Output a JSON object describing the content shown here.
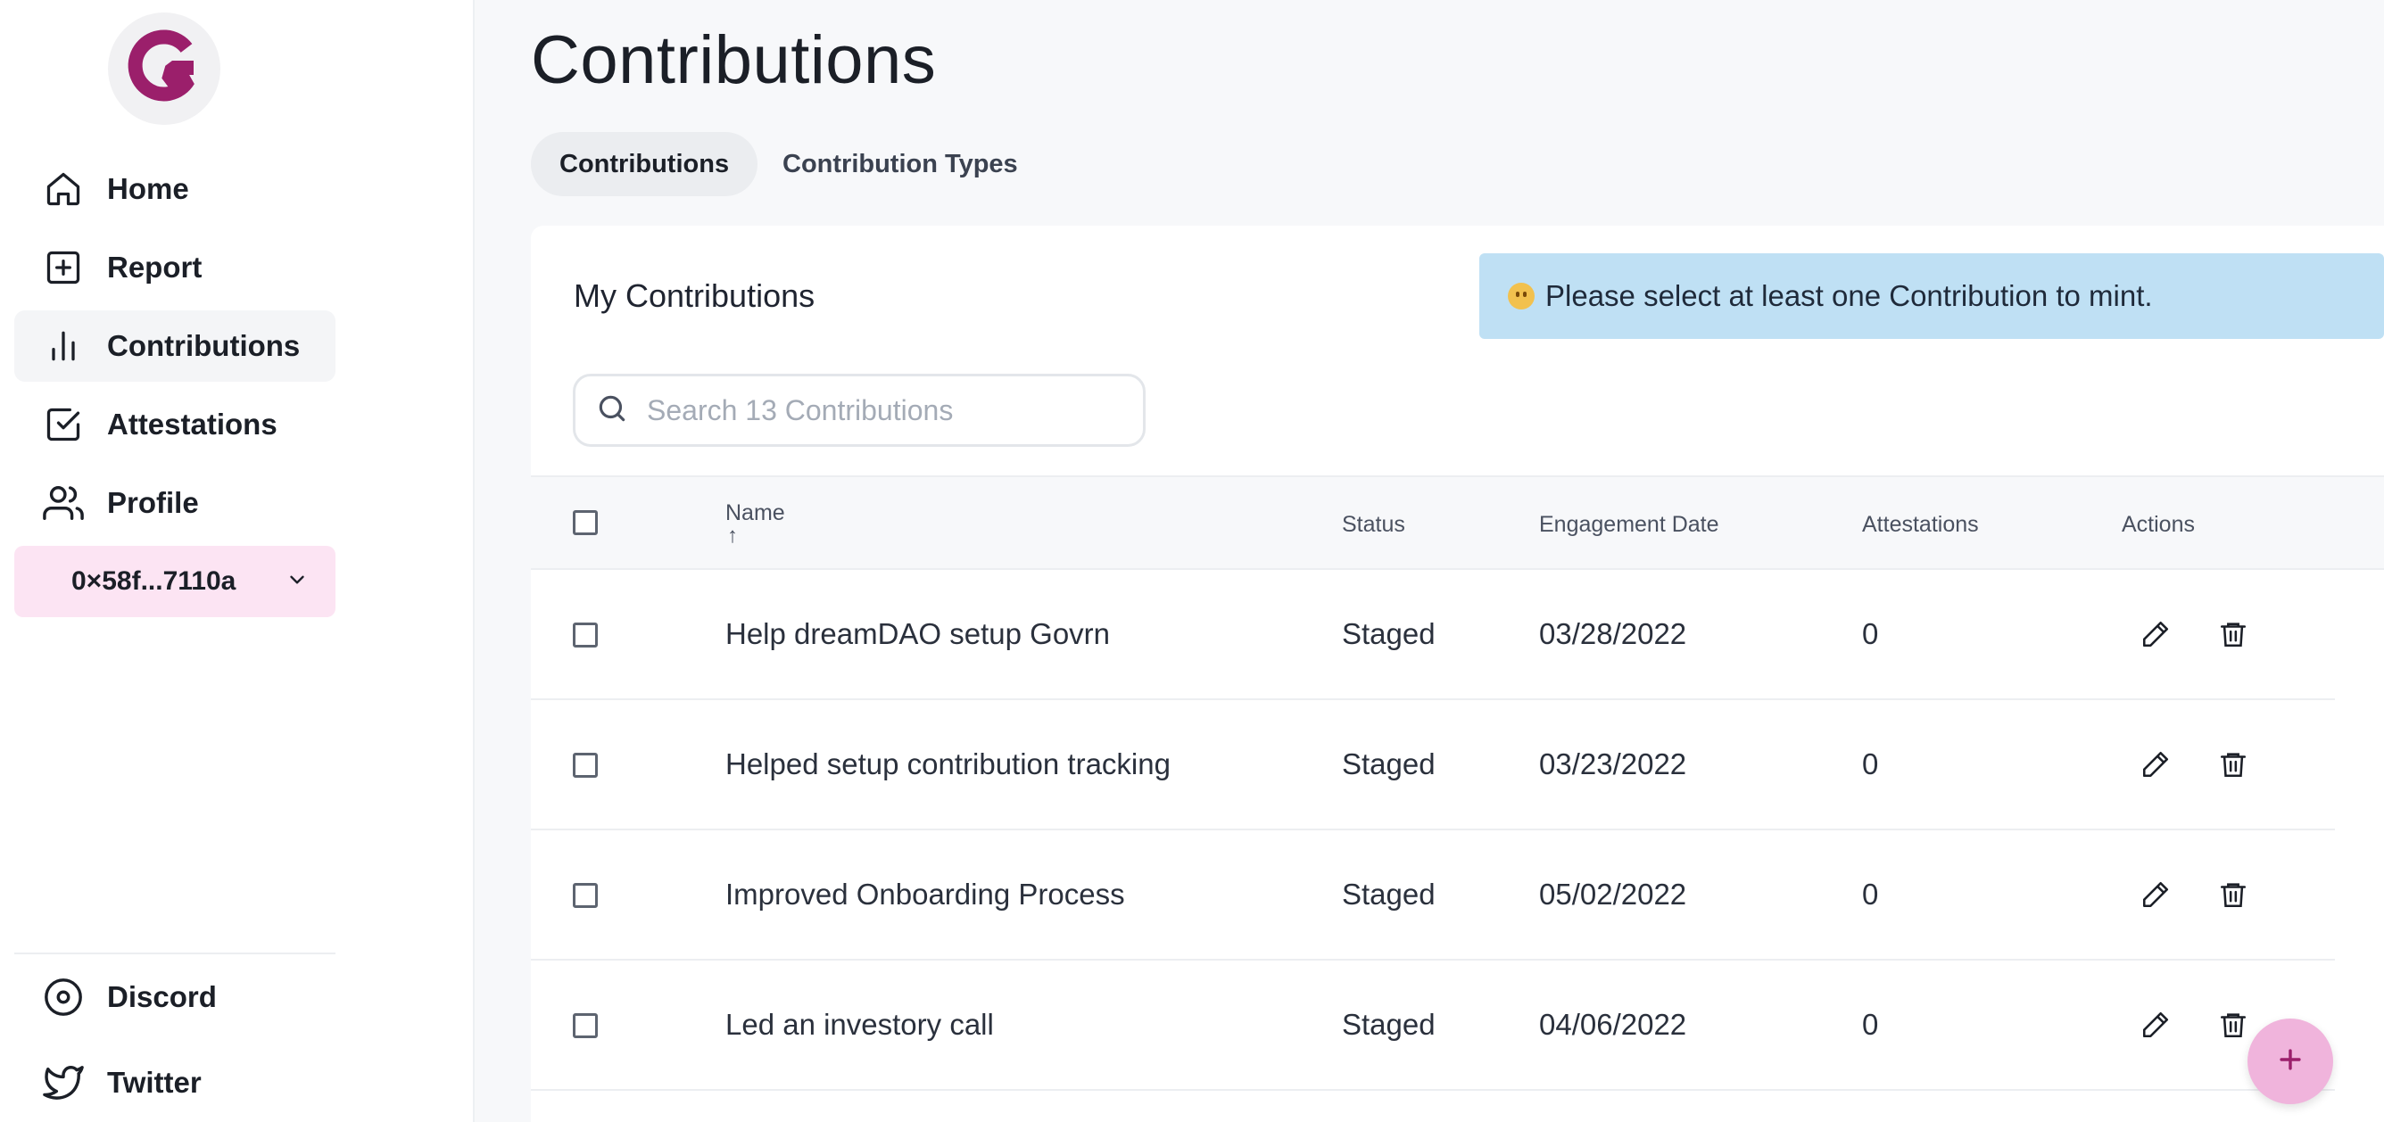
{
  "sidebar": {
    "items": [
      {
        "label": "Home",
        "icon": "home-icon"
      },
      {
        "label": "Report",
        "icon": "plus-square-icon"
      },
      {
        "label": "Contributions",
        "icon": "bar-chart-icon",
        "active": true
      },
      {
        "label": "Attestations",
        "icon": "check-square-icon"
      },
      {
        "label": "Profile",
        "icon": "users-icon"
      }
    ],
    "wallet": "0×58f...7110a",
    "footer": [
      {
        "label": "Discord",
        "icon": "discord-icon"
      },
      {
        "label": "Twitter",
        "icon": "twitter-icon"
      }
    ]
  },
  "page": {
    "title": "Contributions",
    "tabs": [
      "Contributions",
      "Contribution Types"
    ]
  },
  "card": {
    "title": "My Contributions",
    "alert": "Please select at least one Contribution to mint.",
    "search_placeholder": "Search 13 Contributions"
  },
  "table": {
    "columns": {
      "name": "Name",
      "sort": "↑",
      "status": "Status",
      "date": "Engagement Date",
      "attestations": "Attestations",
      "actions": "Actions"
    },
    "rows": [
      {
        "name": "Help dreamDAO setup Govrn",
        "status": "Staged",
        "date": "03/28/2022",
        "attestations": "0"
      },
      {
        "name": "Helped setup contribution tracking",
        "status": "Staged",
        "date": "03/23/2022",
        "attestations": "0"
      },
      {
        "name": "Improved Onboarding Process",
        "status": "Staged",
        "date": "05/02/2022",
        "attestations": "0"
      },
      {
        "name": "Led an investory call",
        "status": "Staged",
        "date": "04/06/2022",
        "attestations": "0"
      }
    ]
  },
  "colors": {
    "brand": "#9b1f6b",
    "accent_pink": "#f0b4dc",
    "alert_bg": "#bfe0f4"
  }
}
